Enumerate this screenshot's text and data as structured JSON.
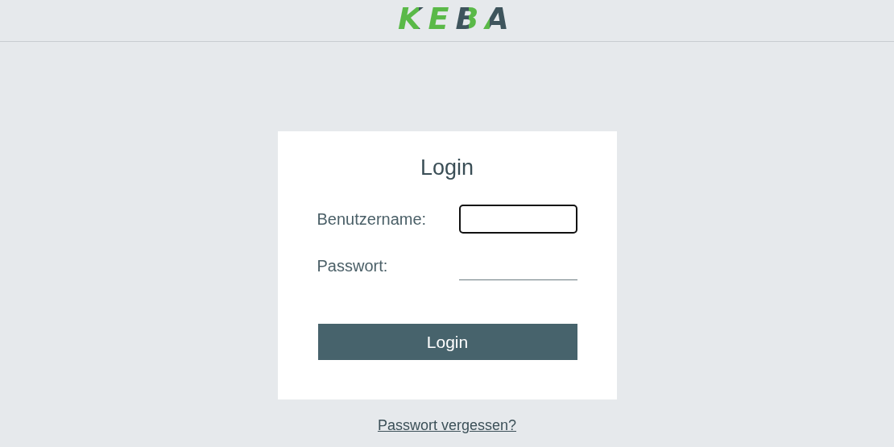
{
  "header": {
    "logo": "KEBA"
  },
  "login_form": {
    "title": "Login",
    "fields": [
      {
        "label": "Benutzername:",
        "focused": true
      },
      {
        "label": "Passwort:",
        "focused": false
      }
    ],
    "submit_button": "Login"
  },
  "forgot_password_link": "Passwort vergessen?"
}
